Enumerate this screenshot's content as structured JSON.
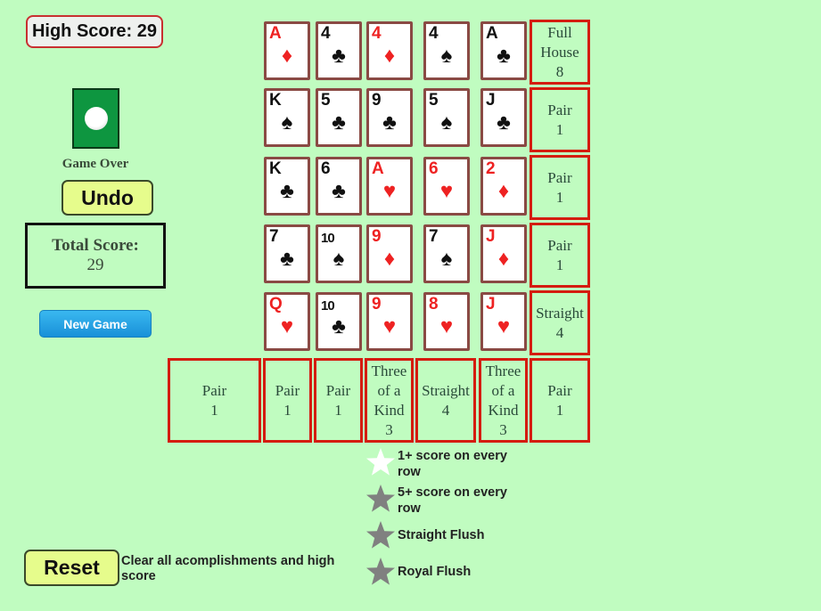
{
  "header": {
    "high_score_label": "High Score: 29"
  },
  "status": {
    "text": "Game Over",
    "deck_icon": "deck-card-back-icon"
  },
  "buttons": {
    "undo": "Undo",
    "new_game": "New Game",
    "reset": "Reset"
  },
  "total": {
    "label": "Total Score:",
    "value": "29"
  },
  "grid": [
    [
      {
        "rank": "A",
        "suit": "♦",
        "color": "red"
      },
      {
        "rank": "4",
        "suit": "♣",
        "color": "black"
      },
      {
        "rank": "4",
        "suit": "♦",
        "color": "red"
      },
      {
        "rank": "4",
        "suit": "♠",
        "color": "black"
      },
      {
        "rank": "A",
        "suit": "♣",
        "color": "black"
      }
    ],
    [
      {
        "rank": "K",
        "suit": "♠",
        "color": "black"
      },
      {
        "rank": "5",
        "suit": "♣",
        "color": "black"
      },
      {
        "rank": "9",
        "suit": "♣",
        "color": "black"
      },
      {
        "rank": "5",
        "suit": "♠",
        "color": "black"
      },
      {
        "rank": "J",
        "suit": "♣",
        "color": "black"
      }
    ],
    [
      {
        "rank": "K",
        "suit": "♣",
        "color": "black"
      },
      {
        "rank": "6",
        "suit": "♣",
        "color": "black"
      },
      {
        "rank": "A",
        "suit": "♥",
        "color": "red"
      },
      {
        "rank": "6",
        "suit": "♥",
        "color": "red"
      },
      {
        "rank": "2",
        "suit": "♦",
        "color": "red"
      }
    ],
    [
      {
        "rank": "7",
        "suit": "♣",
        "color": "black"
      },
      {
        "rank": "10",
        "suit": "♠",
        "color": "black"
      },
      {
        "rank": "9",
        "suit": "♦",
        "color": "red"
      },
      {
        "rank": "7",
        "suit": "♠",
        "color": "black"
      },
      {
        "rank": "J",
        "suit": "♦",
        "color": "red"
      }
    ],
    [
      {
        "rank": "Q",
        "suit": "♥",
        "color": "red"
      },
      {
        "rank": "10",
        "suit": "♣",
        "color": "black"
      },
      {
        "rank": "9",
        "suit": "♥",
        "color": "red"
      },
      {
        "rank": "8",
        "suit": "♥",
        "color": "red"
      },
      {
        "rank": "J",
        "suit": "♥",
        "color": "red"
      }
    ]
  ],
  "row_scores": [
    {
      "hand": "Full House",
      "points": "8"
    },
    {
      "hand": "Pair",
      "points": "1"
    },
    {
      "hand": "Pair",
      "points": "1"
    },
    {
      "hand": "Pair",
      "points": "1"
    },
    {
      "hand": "Straight",
      "points": "4"
    }
  ],
  "column_scores": [
    {
      "hand": "Pair",
      "points": "1"
    },
    {
      "hand": "Pair",
      "points": "1"
    },
    {
      "hand": "Three of a Kind",
      "points": "3"
    },
    {
      "hand": "Straight",
      "points": "4"
    },
    {
      "hand": "Three of a Kind",
      "points": "3"
    }
  ],
  "diagonal_scores": {
    "left": {
      "hand": "Pair",
      "points": "1"
    },
    "right": {
      "hand": "Pair",
      "points": "1"
    }
  },
  "achievements": [
    {
      "label": "1+ score on every row",
      "achieved": true
    },
    {
      "label": "5+ score on every row",
      "achieved": false
    },
    {
      "label": "Straight Flush",
      "achieved": false
    },
    {
      "label": "Royal Flush",
      "achieved": false
    }
  ],
  "reset_description": "Clear all acomplishments and high score",
  "colors": {
    "background": "#c0fcc0",
    "score_border": "#d41c10",
    "card_border": "#8a4a44",
    "star_achieved": "#ffffff",
    "star_locked": "#808080",
    "red_suit": "#ee2222"
  }
}
